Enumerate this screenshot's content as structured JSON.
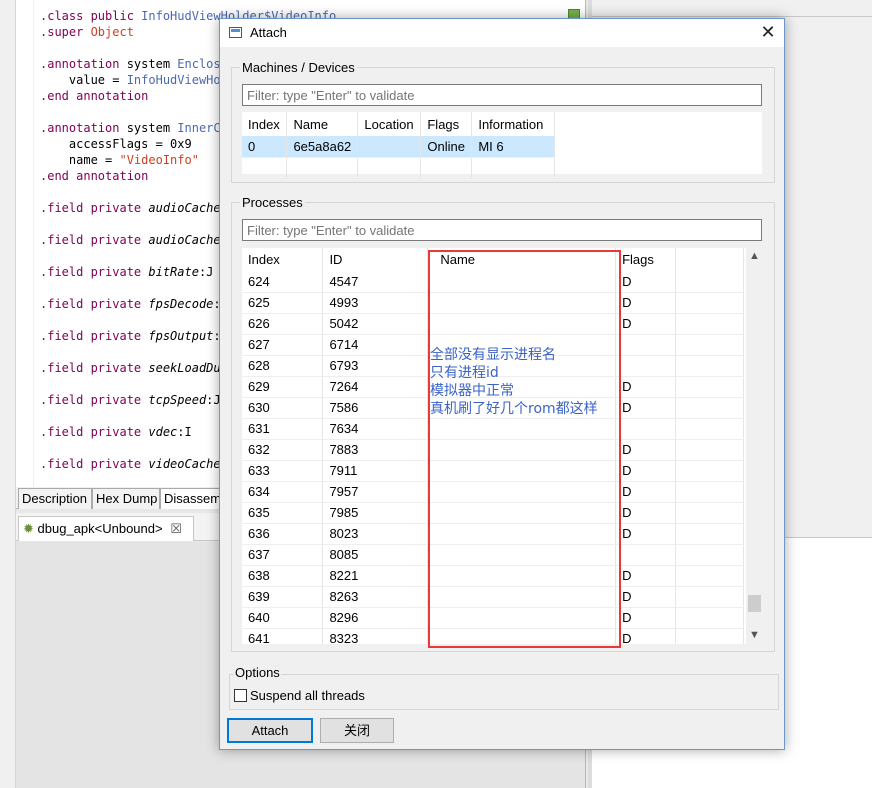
{
  "ide": {
    "code_lines": [
      {
        "parts": [
          {
            "t": ".class ",
            "c": "kw"
          },
          {
            "t": "public ",
            "c": "kw"
          },
          {
            "t": "InfoHudViewHolder$VideoInfo",
            "c": "ty"
          }
        ]
      },
      {
        "parts": [
          {
            "t": ".super ",
            "c": "kw"
          },
          {
            "t": "Object",
            "c": "ty st"
          }
        ]
      },
      {
        "parts": []
      },
      {
        "parts": [
          {
            "t": ".annotation ",
            "c": "kw"
          },
          {
            "t": "system ",
            "c": ""
          },
          {
            "t": "Enclosi",
            "c": "ty"
          }
        ]
      },
      {
        "parts": [
          {
            "t": "    value = ",
            "c": ""
          },
          {
            "t": "InfoHudViewHol",
            "c": "ty"
          }
        ]
      },
      {
        "parts": [
          {
            "t": ".end annotation",
            "c": "kw"
          }
        ]
      },
      {
        "parts": []
      },
      {
        "parts": [
          {
            "t": ".annotation ",
            "c": "kw"
          },
          {
            "t": "system ",
            "c": ""
          },
          {
            "t": "InnerCl",
            "c": "ty"
          }
        ]
      },
      {
        "parts": [
          {
            "t": "    accessFlags = 0x9",
            "c": ""
          }
        ]
      },
      {
        "parts": [
          {
            "t": "    name = ",
            "c": ""
          },
          {
            "t": "\"VideoInfo\"",
            "c": "st"
          }
        ]
      },
      {
        "parts": [
          {
            "t": ".end annotation",
            "c": "kw"
          }
        ]
      },
      {
        "parts": []
      },
      {
        "parts": [
          {
            "t": ".field private ",
            "c": "kw"
          },
          {
            "t": "audioCached",
            "c": "it"
          }
        ]
      },
      {
        "parts": []
      },
      {
        "parts": [
          {
            "t": ".field private ",
            "c": "kw"
          },
          {
            "t": "audioCached",
            "c": "it"
          }
        ]
      },
      {
        "parts": []
      },
      {
        "parts": [
          {
            "t": ".field private ",
            "c": "kw"
          },
          {
            "t": "bitRate",
            "c": "it"
          },
          {
            "t": ":J",
            "c": ""
          }
        ]
      },
      {
        "parts": []
      },
      {
        "parts": [
          {
            "t": ".field private ",
            "c": "kw"
          },
          {
            "t": "fpsDecode",
            "c": "it"
          },
          {
            "t": ":F",
            "c": ""
          }
        ]
      },
      {
        "parts": []
      },
      {
        "parts": [
          {
            "t": ".field private ",
            "c": "kw"
          },
          {
            "t": "fpsOutput",
            "c": "it"
          },
          {
            "t": ":F",
            "c": ""
          }
        ]
      },
      {
        "parts": []
      },
      {
        "parts": [
          {
            "t": ".field private ",
            "c": "kw"
          },
          {
            "t": "seekLoadDur",
            "c": "it"
          }
        ]
      },
      {
        "parts": []
      },
      {
        "parts": [
          {
            "t": ".field private ",
            "c": "kw"
          },
          {
            "t": "tcpSpeed",
            "c": "it"
          },
          {
            "t": ":J",
            "c": ""
          }
        ]
      },
      {
        "parts": []
      },
      {
        "parts": [
          {
            "t": ".field private ",
            "c": "kw"
          },
          {
            "t": "vdec",
            "c": "it"
          },
          {
            "t": ":I",
            "c": ""
          }
        ]
      },
      {
        "parts": []
      },
      {
        "parts": [
          {
            "t": ".field private ",
            "c": "kw"
          },
          {
            "t": "videoCached",
            "c": "it"
          }
        ]
      }
    ],
    "bottom_tabs": [
      "Description",
      "Hex Dump",
      "Disassem"
    ],
    "debug_tab_label": "dbug_apk<Unbound>",
    "debug_tab_close": "☒"
  },
  "dialog": {
    "title": "Attach",
    "close_glyph": "✕",
    "machines": {
      "label": "Machines / Devices",
      "filter_placeholder": "Filter: type \"Enter\" to validate",
      "columns": [
        "Index",
        "Name",
        "Location",
        "Flags",
        "Information"
      ],
      "rows": [
        [
          "0",
          "6e5a8a62",
          "",
          "Online",
          "MI 6"
        ]
      ]
    },
    "processes": {
      "label": "Processes",
      "filter_placeholder": "Filter: type \"Enter\" to validate",
      "columns": [
        "Index",
        "ID",
        "Name",
        "Flags"
      ],
      "rows": [
        [
          "624",
          "4547",
          "",
          "D"
        ],
        [
          "625",
          "4993",
          "",
          "D"
        ],
        [
          "626",
          "5042",
          "",
          "D"
        ],
        [
          "627",
          "6714",
          "",
          ""
        ],
        [
          "628",
          "6793",
          "",
          ""
        ],
        [
          "629",
          "7264",
          "",
          "D"
        ],
        [
          "630",
          "7586",
          "",
          "D"
        ],
        [
          "631",
          "7634",
          "",
          ""
        ],
        [
          "632",
          "7883",
          "",
          "D"
        ],
        [
          "633",
          "7911",
          "",
          "D"
        ],
        [
          "634",
          "7957",
          "",
          "D"
        ],
        [
          "635",
          "7985",
          "",
          "D"
        ],
        [
          "636",
          "8023",
          "",
          "D"
        ],
        [
          "637",
          "8085",
          "",
          ""
        ],
        [
          "638",
          "8221",
          "",
          "D"
        ],
        [
          "639",
          "8263",
          "",
          "D"
        ],
        [
          "640",
          "8296",
          "",
          "D"
        ],
        [
          "641",
          "8323",
          "",
          "D"
        ]
      ]
    },
    "annotation": "全部没有显示进程名\n只有进程id\n模拟器中正常\n真机刷了好几个rom都这样",
    "options": {
      "label": "Options",
      "suspend_label": "Suspend all threads",
      "suspend_checked": false
    },
    "buttons": {
      "attach": "Attach",
      "close": "关闭"
    }
  }
}
